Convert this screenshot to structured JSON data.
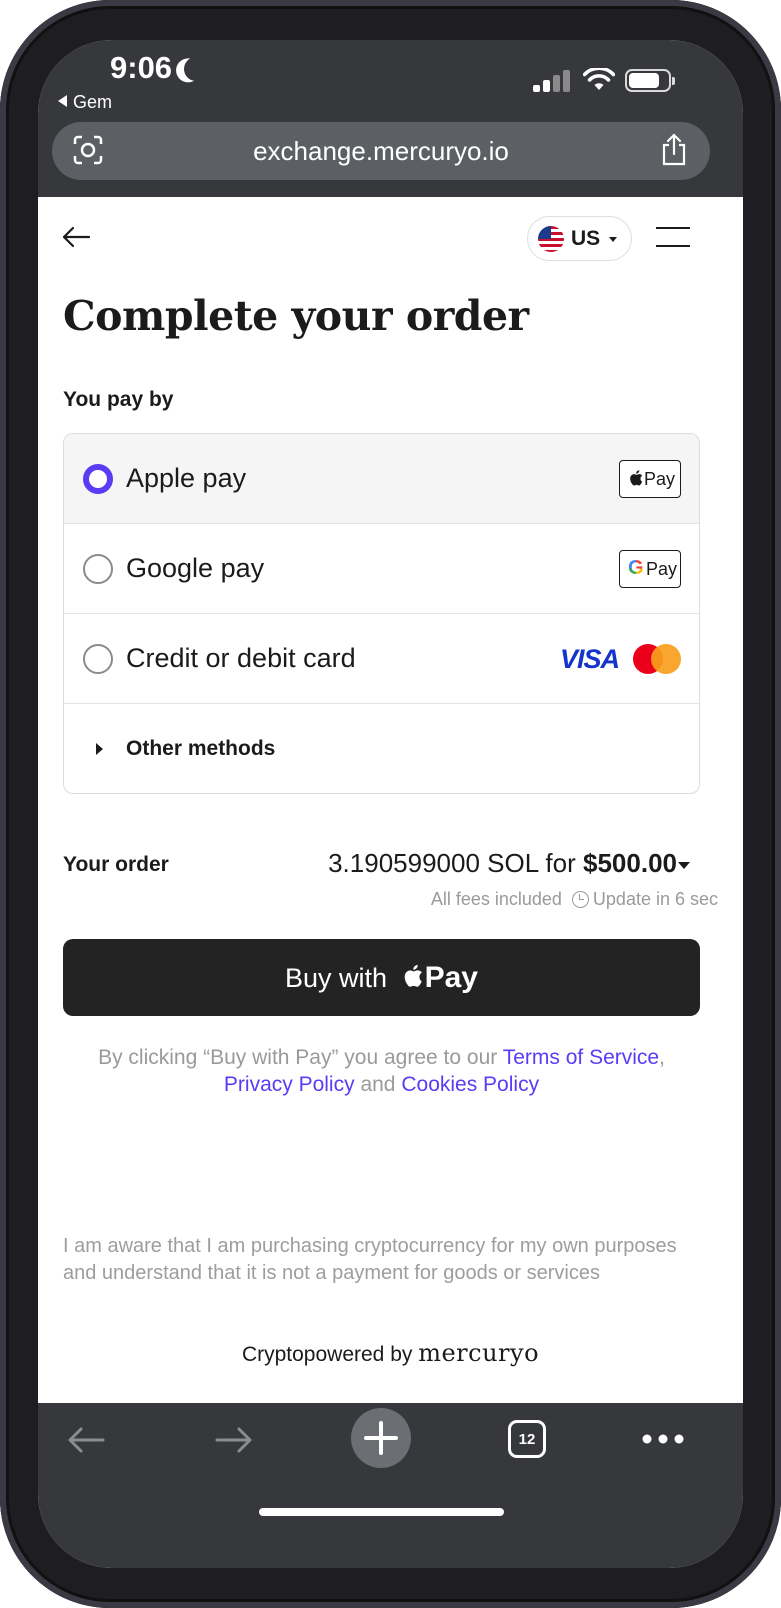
{
  "status_bar": {
    "time": "9:06",
    "back_app": "Gem"
  },
  "browser": {
    "url": "exchange.mercuryo.io",
    "tab_count": "12"
  },
  "header": {
    "language": "US"
  },
  "page": {
    "title": "Complete your order",
    "pay_by_label": "You pay by"
  },
  "payment_methods": [
    {
      "label": "Apple pay",
      "selected": true,
      "badge": "Pay"
    },
    {
      "label": "Google pay",
      "selected": false,
      "badge": "Pay",
      "badge_g": "G"
    },
    {
      "label": "Credit or debit card",
      "selected": false,
      "badge": "VISA"
    }
  ],
  "other_methods_label": "Other methods",
  "order": {
    "label": "Your order",
    "amount": "3.190599000 SOL for",
    "price": "$500.00",
    "fees": "All fees included",
    "update": "Update in 6 sec"
  },
  "buy_button": {
    "prefix": "Buy with",
    "pay": "Pay"
  },
  "terms": {
    "prefix": "By clicking “Buy with Pay” you agree to our",
    "tos": "Terms of Service",
    "comma": ",",
    "privacy": "Privacy Policy",
    "and": "and",
    "cookies": "Cookies Policy"
  },
  "disclaimer": "I am aware that I am purchasing cryptocurrency for my own purposes and understand that it is not a payment for goods or services",
  "powered_by": {
    "prefix": "Cryptopowered by",
    "brand": "mercuryo"
  },
  "colors": {
    "accent": "#5b3cf4",
    "button_dark": "#232323",
    "chrome": "#36383b"
  }
}
